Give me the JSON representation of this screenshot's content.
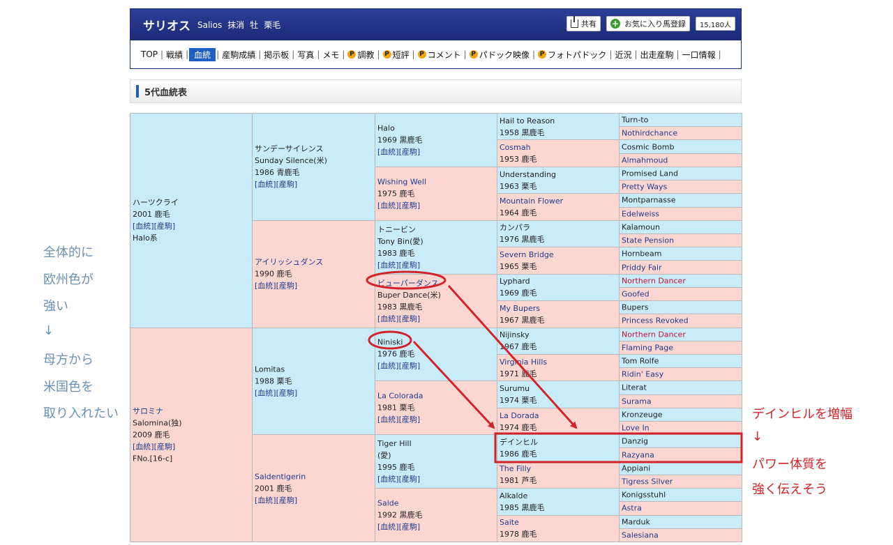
{
  "header": {
    "horse_name": "サリオス",
    "horse_name_en": "Salios",
    "status": "抹消",
    "sex": "牡",
    "coat": "栗毛",
    "share_label": "共有",
    "favorite_label": "お気に入り馬登録",
    "favorite_count": "15,180人"
  },
  "nav": [
    {
      "label": "TOP",
      "p": false,
      "active": false
    },
    {
      "label": "戦績",
      "p": false,
      "active": false
    },
    {
      "label": "血統",
      "p": false,
      "active": true
    },
    {
      "label": "産駒成績",
      "p": false,
      "active": false
    },
    {
      "label": "掲示板",
      "p": false,
      "active": false
    },
    {
      "label": "写真",
      "p": false,
      "active": false
    },
    {
      "label": "メモ",
      "p": false,
      "active": false
    },
    {
      "label": "調教",
      "p": true,
      "active": false
    },
    {
      "label": "短評",
      "p": true,
      "active": false
    },
    {
      "label": "コメント",
      "p": true,
      "active": false
    },
    {
      "label": "パドック映像",
      "p": true,
      "active": false
    },
    {
      "label": "フォトパドック",
      "p": true,
      "active": false
    },
    {
      "label": "近況",
      "p": false,
      "active": false
    },
    {
      "label": "出走産駒",
      "p": false,
      "active": false
    },
    {
      "label": "一口情報",
      "p": false,
      "active": false
    }
  ],
  "section_title": "5代血統表",
  "pedigree": {
    "g1": [
      {
        "name": "ハーツクライ",
        "sub": "",
        "year": "2001 鹿毛",
        "links": "[血統][産駒]",
        "extra": "Halo系"
      },
      {
        "name": "サロミナ",
        "sub": "Salomina(独)",
        "year": "2009 鹿毛",
        "links": "[血統][産駒]",
        "extra": "FNo.[16-c]"
      }
    ],
    "g2": [
      {
        "name": "サンデーサイレンス",
        "sub": "Sunday Silence(米)",
        "year": "1986 青鹿毛",
        "links": "[血統][産駒]"
      },
      {
        "name": "アイリッシュダンス",
        "sub": "",
        "year": "1990 鹿毛",
        "links": "[血統][産駒]"
      },
      {
        "name": "Lomitas",
        "sub": "",
        "year": "1988 栗毛",
        "links": "[血統][産駒]"
      },
      {
        "name": "Saldentigerin",
        "sub": "",
        "year": "2001 鹿毛",
        "links": "[血統][産駒]"
      }
    ],
    "g3": [
      {
        "name": "Halo",
        "sub": "",
        "year": "1969 黒鹿毛",
        "links": "[血統][産駒]"
      },
      {
        "name": "Wishing Well",
        "sub": "",
        "year": "1975 鹿毛",
        "links": "[血統][産駒]"
      },
      {
        "name": "トニービン",
        "sub": "Tony Bin(愛)",
        "year": "1983 鹿毛",
        "links": "[血統][産駒]"
      },
      {
        "name": "ビューパーダンス",
        "sub": "Buper Dance(米)",
        "year": "1983 黒鹿毛",
        "links": "[血統][産駒]"
      },
      {
        "name": "Niniski",
        "sub": "",
        "year": "1976 鹿毛",
        "links": "[血統][産駒]"
      },
      {
        "name": "La Colorada",
        "sub": "",
        "year": "1981 栗毛",
        "links": "[血統][産駒]"
      },
      {
        "name": "Tiger Hill",
        "sub": "(愛)",
        "year": "1995 鹿毛",
        "links": "[血統][産駒]"
      },
      {
        "name": "Salde",
        "sub": "",
        "year": "1992 黒鹿毛",
        "links": "[血統][産駒]"
      }
    ],
    "g4": [
      {
        "name": "Hail to Reason",
        "year": "1958 黒鹿毛"
      },
      {
        "name": "Cosmah",
        "year": "1953 鹿毛"
      },
      {
        "name": "Understanding",
        "year": "1963 栗毛"
      },
      {
        "name": "Mountain Flower",
        "year": "1964 鹿毛"
      },
      {
        "name": "カンパラ",
        "year": "1976 黒鹿毛"
      },
      {
        "name": "Severn Bridge",
        "year": "1965 栗毛"
      },
      {
        "name": "Lyphard",
        "year": "1969 鹿毛"
      },
      {
        "name": "My Bupers",
        "year": "1967 黒鹿毛"
      },
      {
        "name": "Nijinsky",
        "year": "1967 鹿毛"
      },
      {
        "name": "Virginia Hills",
        "year": "1971 鹿毛"
      },
      {
        "name": "Surumu",
        "year": "1974 栗毛"
      },
      {
        "name": "La Dorada",
        "year": "1974 鹿毛"
      },
      {
        "name": "デインヒル",
        "year": "1986 鹿毛"
      },
      {
        "name": "The Filly",
        "year": "1981 芦毛"
      },
      {
        "name": "Alkalde",
        "year": "1985 黒鹿毛"
      },
      {
        "name": "Saite",
        "year": "1978 鹿毛"
      }
    ],
    "g5": [
      {
        "name": "Turn-to",
        "red": false
      },
      {
        "name": "Nothirdchance",
        "red": false
      },
      {
        "name": "Cosmic Bomb",
        "red": false
      },
      {
        "name": "Almahmoud",
        "red": false
      },
      {
        "name": "Promised Land",
        "red": false
      },
      {
        "name": "Pretty Ways",
        "red": false
      },
      {
        "name": "Montparnasse",
        "red": false
      },
      {
        "name": "Edelweiss",
        "red": false
      },
      {
        "name": "Kalamoun",
        "red": false
      },
      {
        "name": "State Pension",
        "red": false
      },
      {
        "name": "Hornbeam",
        "red": false
      },
      {
        "name": "Priddy Fair",
        "red": false
      },
      {
        "name": "Northern Dancer",
        "red": true
      },
      {
        "name": "Goofed",
        "red": false
      },
      {
        "name": "Bupers",
        "red": false
      },
      {
        "name": "Princess Revoked",
        "red": false
      },
      {
        "name": "Northern Dancer",
        "red": true
      },
      {
        "name": "Flaming Page",
        "red": false
      },
      {
        "name": "Tom Rolfe",
        "red": false
      },
      {
        "name": "Ridin' Easy",
        "red": false
      },
      {
        "name": "Literat",
        "red": false
      },
      {
        "name": "Surama",
        "red": false
      },
      {
        "name": "Kronzeuge",
        "red": false
      },
      {
        "name": "Love In",
        "red": false
      },
      {
        "name": "Danzig",
        "red": false
      },
      {
        "name": "Razyana",
        "red": false
      },
      {
        "name": "Appiani",
        "red": false
      },
      {
        "name": "Tigress Silver",
        "red": false
      },
      {
        "name": "Konigsstuhl",
        "red": false
      },
      {
        "name": "Astra",
        "red": false
      },
      {
        "name": "Marduk",
        "red": false
      },
      {
        "name": "Salesiana",
        "red": false
      }
    ]
  },
  "annotations": {
    "left": [
      "全体的に",
      "欧州色が",
      "強い",
      "↓",
      "母方から",
      "米国色を",
      "取り入れたい"
    ],
    "right": [
      "デインヒルを増幅",
      "↓",
      "パワー体質を",
      "強く伝えそう"
    ]
  },
  "colors": {
    "male_bg": "#c9ecfb",
    "female_bg": "#fcd7d2",
    "annotation_red": "#d2232a",
    "annotation_blue": "#6d8fb4",
    "header_navy": "#1b2a78",
    "active_tab": "#1f5fc2"
  }
}
